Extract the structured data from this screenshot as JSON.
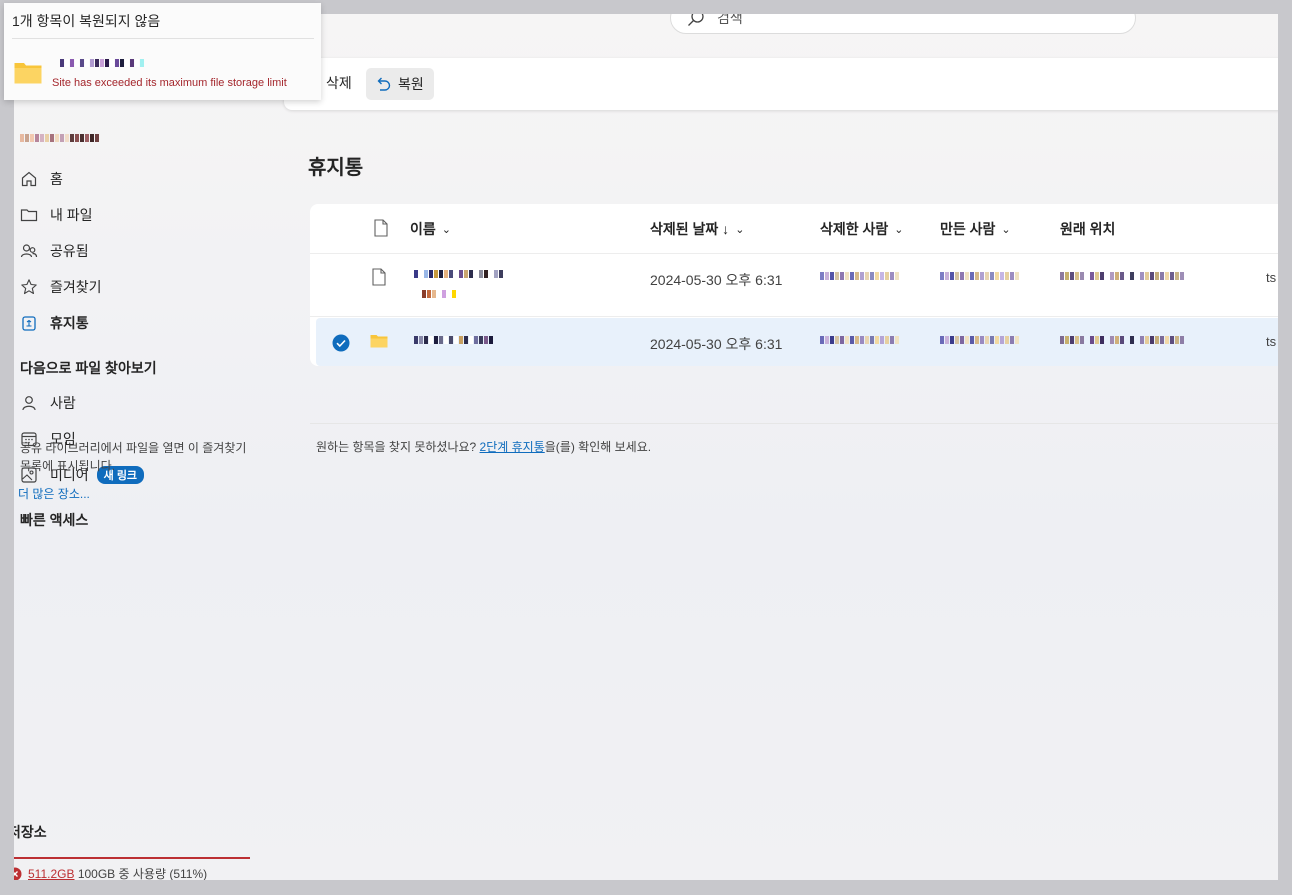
{
  "search": {
    "placeholder": "검색"
  },
  "toolbar": {
    "delete_label": "삭제",
    "restore_label": "복원"
  },
  "toast": {
    "title": "1개 항목이 복원되지 않음",
    "error": "Site has exceeded its maximum file storage limit"
  },
  "sidebar": {
    "items": [
      {
        "label": "홈",
        "icon": "home-icon"
      },
      {
        "label": "내 파일",
        "icon": "folder-icon"
      },
      {
        "label": "공유됨",
        "icon": "people-icon"
      },
      {
        "label": "즐겨찾기",
        "icon": "star-icon"
      },
      {
        "label": "휴지통",
        "icon": "recycle-bin-icon",
        "active": true
      }
    ],
    "browse_title": "다음으로 파일 찾아보기",
    "browse_items": [
      {
        "label": "사람",
        "icon": "person-icon"
      },
      {
        "label": "모임",
        "icon": "calendar-icon"
      },
      {
        "label": "미디어",
        "icon": "image-icon",
        "badge": "새 링크"
      }
    ],
    "quick_access_title": "빠른 액세스",
    "quick_access_desc": "공유 라이브러리에서 파일을 열면 이 즐겨찾기 목록에 표시됩니다.",
    "more_places": "더 많은 장소..."
  },
  "storage": {
    "title": "저장소",
    "used": "511.2GB",
    "rest": "100GB 중 사용량 (511%)",
    "status_color": "#bc2f32"
  },
  "main": {
    "title": "휴지통",
    "columns": [
      "이름",
      "삭제된 날짜 ↓",
      "삭제한 사람",
      "만든 사람",
      "원래 위치"
    ],
    "rows": [
      {
        "type": "file",
        "deleted": "2024-05-30 오후 6:31",
        "location_suffix": "ts",
        "selected": false
      },
      {
        "type": "folder",
        "deleted": "2024-05-30 오후 6:31",
        "location_suffix": "ts",
        "selected": true
      }
    ],
    "hint_before": "원하는 항목을 찾지 못하셨나요? ",
    "hint_link": "2단계 휴지통",
    "hint_after": "을(를) 확인해 보세요."
  },
  "colors": {
    "accent": "#0f6cbd",
    "error": "#a4262c",
    "folder": "#f8c53a"
  }
}
